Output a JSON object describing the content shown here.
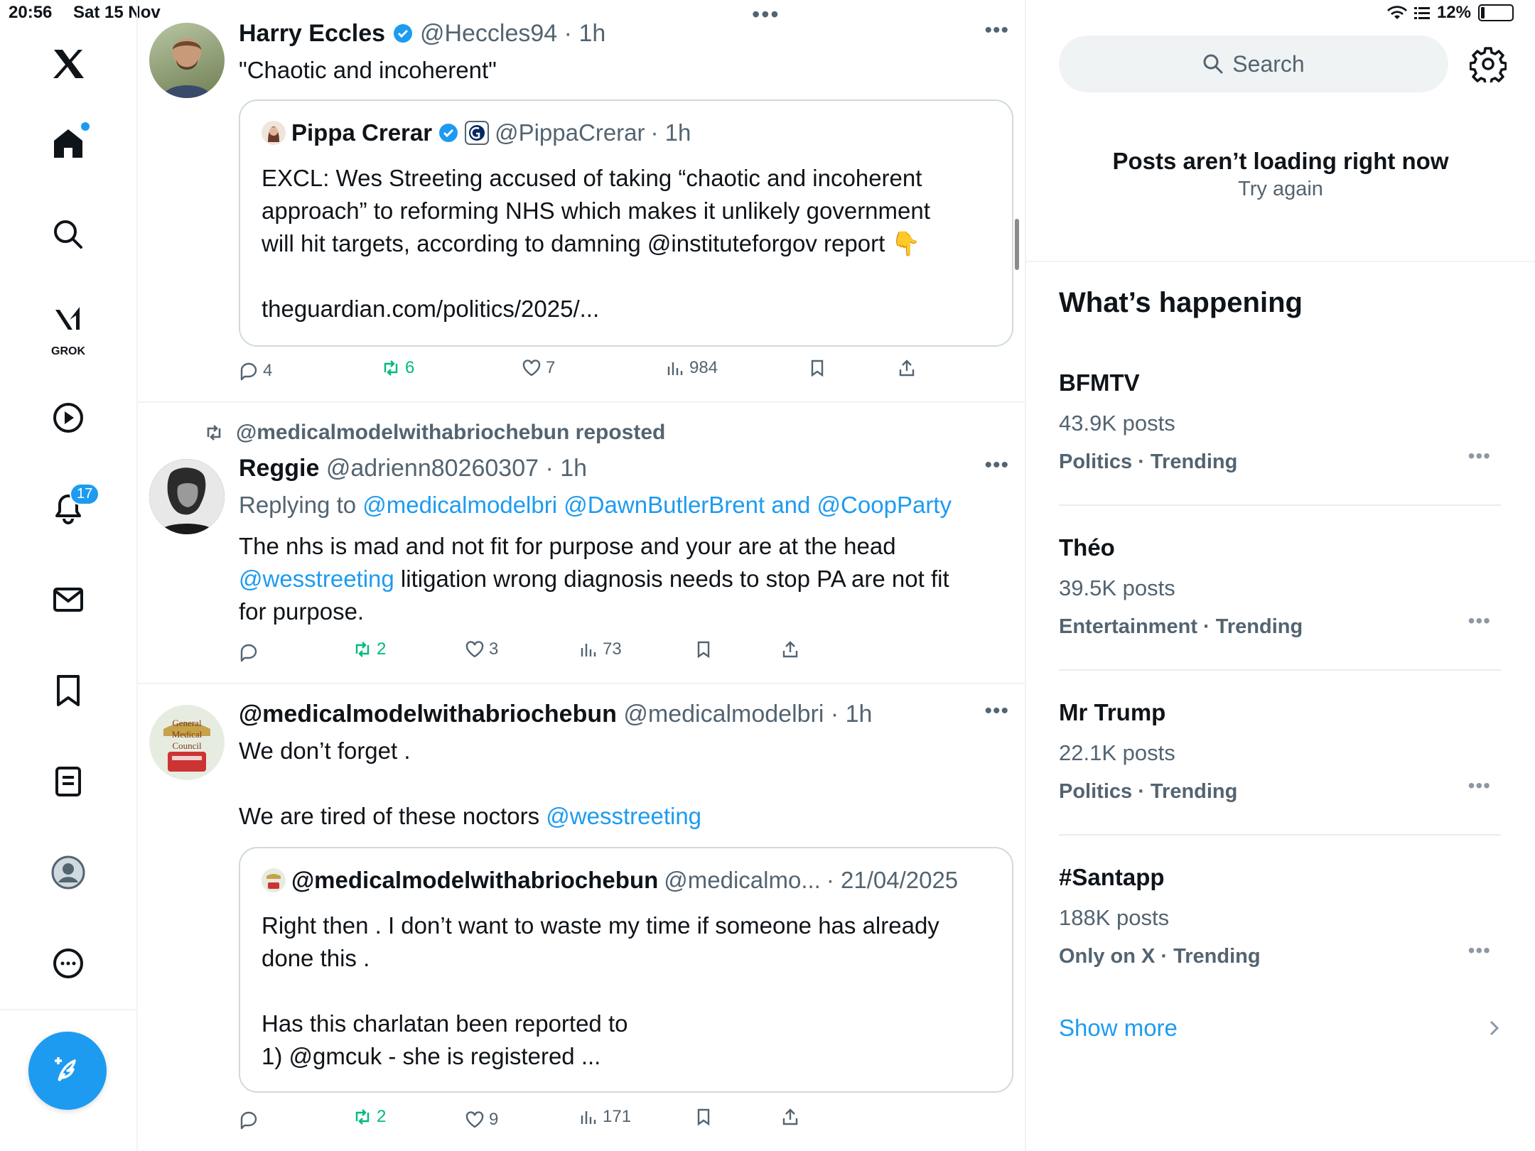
{
  "status_bar": {
    "time": "20:56",
    "date": "Sat 15 Nov",
    "battery": "12%",
    "battery_level": 0.12
  },
  "sidebar": {
    "items": [
      {
        "label": "X",
        "icon": "x-logo-icon"
      },
      {
        "label": "Home",
        "icon": "home-icon",
        "has_dot": true
      },
      {
        "label": "Explore",
        "icon": "search-icon"
      },
      {
        "label": "GROK",
        "icon": "grok-icon"
      },
      {
        "label": "Videos",
        "icon": "play-icon"
      },
      {
        "label": "Notifications",
        "icon": "bell-icon",
        "badge": "17"
      },
      {
        "label": "Messages",
        "icon": "mail-icon"
      },
      {
        "label": "Bookmarks",
        "icon": "bookmark-icon"
      },
      {
        "label": "Lists",
        "icon": "list-icon"
      },
      {
        "label": "Profile",
        "icon": "profile-icon"
      },
      {
        "label": "More",
        "icon": "more-circle-icon"
      }
    ],
    "compose": {
      "icon": "compose-icon"
    }
  },
  "timeline": {
    "tweets": [
      {
        "name": "Harry Eccles",
        "handle": "@Heccles94",
        "time": "· 1h",
        "verified": true,
        "text": "\"Chaotic and incoherent\"",
        "quote": {
          "name": "Pippa Crerar",
          "handle": "@PippaCrerar",
          "time": "· 1h",
          "text_line1": "EXCL: Wes Streeting accused of taking “chaotic and incoherent",
          "text_line2": "approach” to reforming NHS which makes it unlikely government",
          "text_line3": "will hit targets, according to damning @instituteforgov report 👇",
          "link": "theguardian.com/politics/2025/..."
        },
        "stats": {
          "replies": "4",
          "reposts": "6",
          "likes": "7",
          "views": "984"
        }
      },
      {
        "reposted_by": "@medicalmodelwithabriochebun reposted",
        "name": "Reggie",
        "handle": "@adrienn80260307",
        "time": "· 1h",
        "replying_prefix": "Replying to",
        "replying_to": "@medicalmodelbri @DawnButlerBrent and @CoopParty",
        "text_part1": "The nhs is mad and not fit for purpose and your are at the head",
        "mention": "@wesstreeting",
        "text_part2": " litigation wrong diagnosis needs to stop PA are not fit",
        "text_part3": "for purpose.",
        "stats": {
          "replies": "",
          "reposts": "2",
          "likes": "3",
          "views": "73"
        }
      },
      {
        "name": "@medicalmodelwithabriochebun",
        "handle": "@medicalmodelbri",
        "time": "· 1h",
        "text_line1": "We don’t forget .",
        "text_line2": "We are tired of these noctors ",
        "mention": "@wesstreeting",
        "quote": {
          "name": "@medicalmodelwithabriochebun",
          "handle": "@medicalmo...",
          "time": "· 21/04/2025",
          "text_line1": "Right then . I don’t want to waste my time if someone has already",
          "text_line2": "done this .",
          "text_line3": "Has this charlatan been reported to",
          "text_line4": "1) @gmcuk - she is registered ..."
        },
        "stats": {
          "replies": "",
          "reposts": "2",
          "likes": "9",
          "views": "171"
        }
      }
    ]
  },
  "right": {
    "search_placeholder": "Search",
    "error_title": "Posts aren’t loading right now",
    "error_retry": "Try again",
    "happening_title": "What’s happening",
    "trends": [
      {
        "name": "BFMTV",
        "posts": "43.9K posts",
        "category": "Politics · Trending"
      },
      {
        "name": "Théo",
        "posts": "39.5K posts",
        "category": "Entertainment · Trending"
      },
      {
        "name": "Mr Trump",
        "posts": "22.1K posts",
        "category": "Politics · Trending"
      },
      {
        "name": "#Santapp",
        "posts": "188K posts",
        "category": "Only on X · Trending"
      }
    ],
    "show_more": "Show more"
  },
  "colors": {
    "accent": "#1d9bf0",
    "repost_green": "#00ba7c",
    "muted": "#536471"
  }
}
